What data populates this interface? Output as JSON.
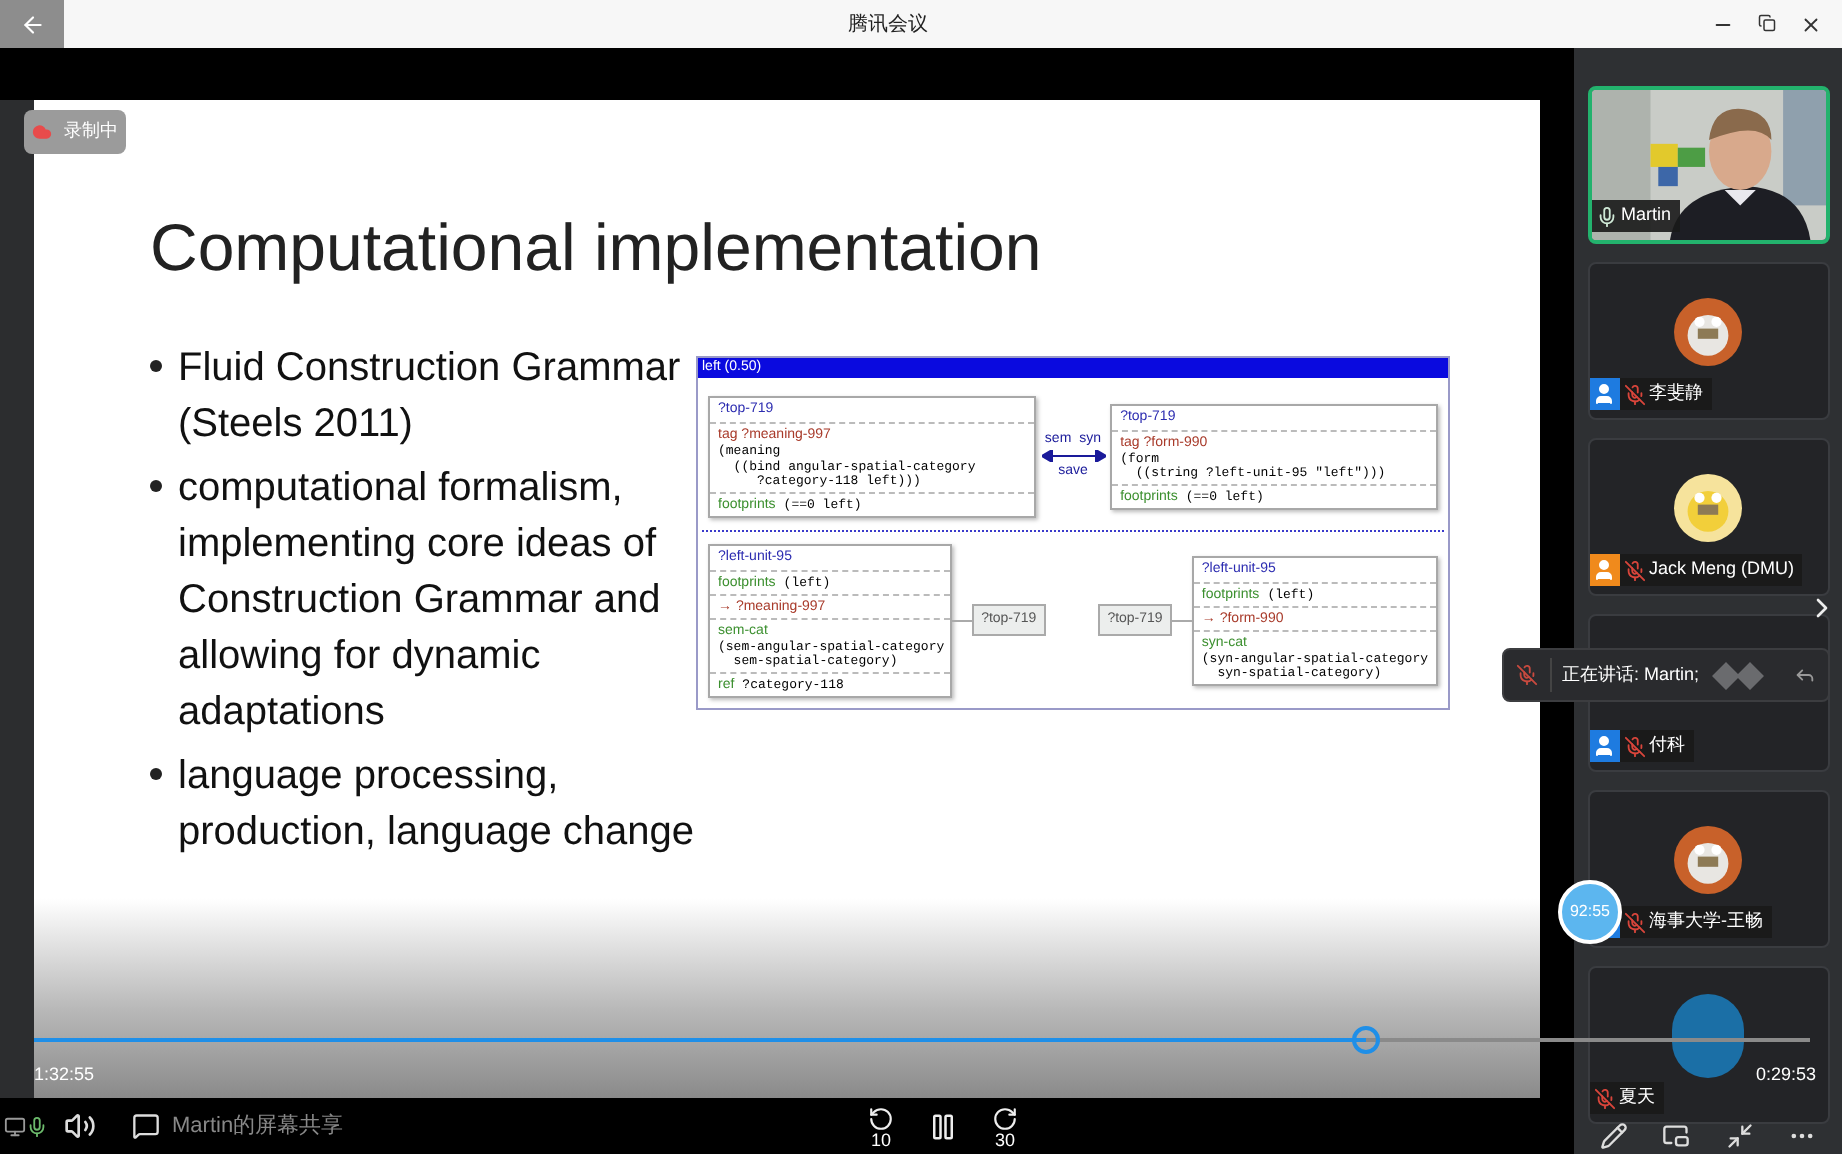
{
  "window": {
    "title": "腾讯会议"
  },
  "recording_badge": {
    "label": "录制中"
  },
  "slide": {
    "title": "Computational implementation",
    "bullets": [
      {
        "lines": [
          "Fluid Construction Grammar",
          "(Steels 2011)"
        ]
      },
      {
        "lines": [
          "computational formalism,",
          "implementing core ideas of",
          "Construction Grammar and",
          "allowing for dynamic",
          "adaptations"
        ]
      },
      {
        "lines": [
          "language processing,",
          "production, language change"
        ]
      }
    ],
    "diagram": {
      "header": "left (0.50)",
      "top_left": {
        "title": "?top-719",
        "rows": [
          {
            "kind": "tag",
            "label": "tag ?meaning-997",
            "value": [
              "(meaning",
              "  ((bind angular-spatial-category",
              "     ?category-118 left)))"
            ]
          },
          {
            "kind": "inline",
            "label": "footprints",
            "value": [
              "(==0 left)"
            ]
          }
        ]
      },
      "link": {
        "left_label": "sem",
        "right_label": "syn",
        "below_label": "save"
      },
      "top_right": {
        "title": "?top-719",
        "rows": [
          {
            "kind": "tag",
            "label": "tag ?form-990",
            "value": [
              "(form",
              "  ((string ?left-unit-95 \"left\")))"
            ]
          },
          {
            "kind": "inline",
            "label": "footprints",
            "value": [
              "(==0 left)"
            ]
          }
        ]
      },
      "bottom_left": {
        "title": "?left-unit-95",
        "rows": [
          {
            "kind": "inline",
            "label": "footprints",
            "value": [
              "(left)"
            ]
          },
          {
            "kind": "arrow",
            "label": "→ ?meaning-997"
          },
          {
            "kind": "block",
            "label": "sem-cat",
            "value": [
              "(sem-angular-spatial-category",
              "  sem-spatial-category)"
            ]
          },
          {
            "kind": "inline",
            "label": "ref",
            "value": [
              "?category-118"
            ]
          }
        ]
      },
      "bottom_left_parent": "?top-719",
      "bottom_right_parent": "?top-719",
      "bottom_right": {
        "title": "?left-unit-95",
        "rows": [
          {
            "kind": "inline",
            "label": "footprints",
            "value": [
              "(left)"
            ]
          },
          {
            "kind": "arrow",
            "label": "→ ?form-990"
          },
          {
            "kind": "block",
            "label": "syn-cat",
            "value": [
              "(syn-angular-spatial-category",
              "  syn-spatial-category)"
            ]
          }
        ]
      }
    }
  },
  "participants": [
    {
      "name": "Martin",
      "kind": "video",
      "muted": false,
      "speaking": true
    },
    {
      "name": "李斐静",
      "kind": "avatar",
      "muted": true,
      "speaking": false,
      "color": "#1e7be0"
    },
    {
      "name": "Jack Meng (DMU)",
      "kind": "avatar",
      "muted": true,
      "speaking": false,
      "color": "#f08a1c"
    },
    {
      "name": "付科",
      "kind": "hidden",
      "muted": true,
      "speaking": false,
      "color": "#1e7be0"
    },
    {
      "name": "海事大学-王畅",
      "kind": "avatar",
      "muted": true,
      "speaking": false,
      "color": "#1e7be0"
    },
    {
      "name": "夏天",
      "kind": "circle",
      "muted": true,
      "speaking": false
    }
  ],
  "speaking_toast": {
    "text": "正在讲话: Martin;"
  },
  "timer_bubble": {
    "text": "92:55"
  },
  "player": {
    "elapsed": "1:32:55",
    "remaining": "0:29:53",
    "level": 0.75,
    "back_label": "10",
    "forward_label": "30"
  },
  "share_label": "Martin的屏幕共享"
}
